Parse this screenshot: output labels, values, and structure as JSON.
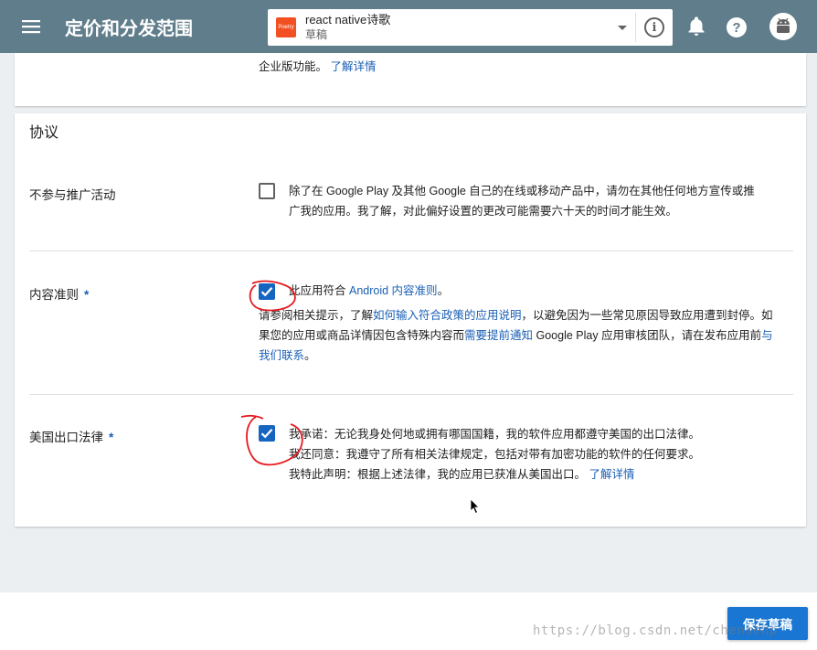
{
  "header": {
    "title": "定价和分发范围",
    "app_name": "react native诗歌",
    "app_status": "草稿",
    "app_icon_text": "Poetry",
    "icons": [
      "menu-icon",
      "info-icon",
      "bell-icon",
      "help-icon",
      "android-avatar-icon"
    ]
  },
  "top_card": {
    "text": "企业版功能。",
    "link": "了解详情"
  },
  "agreement": {
    "title": "协议",
    "promo": {
      "label": "不参与推广活动",
      "checked": false,
      "line1": "除了在 Google Play 及其他 Google 自己的在线或移动产品中，请勿在其他任何地方宣传或推",
      "line2": "广我的应用。我了解，对此偏好设置的更改可能需要六十天的时间才能生效。"
    },
    "content": {
      "label": "内容准则",
      "required": "*",
      "checked": true,
      "line1_pre": "此应用符合",
      "line1_link": "Android 内容准则",
      "line1_post": "。",
      "p_pre": "请参阅相关提示，了解",
      "p_link1": "如何输入符合政策的应用说明",
      "p_mid1": "，以避免因为一些常见原因导致应用遭到封停。如",
      "p_line2_pre": "果您的应用或商品详情因包含特殊内容而",
      "p_link2": "需要提前通知",
      "p_line2_post": " Google Play 应用审核团队，请在发布应用前",
      "p_link3a": "与",
      "p_link3b": "我们联系",
      "p_end": "。"
    },
    "export": {
      "label": "美国出口法律",
      "required": "*",
      "checked": true,
      "line1": "我承诺：无论我身处何地或拥有哪国国籍，我的软件应用都遵守美国的出口法律。",
      "line2": "我还同意：我遵守了所有相关法律规定，包括对带有加密功能的软件的任何要求。",
      "line3": "我特此声明：根据上述法律，我的应用已获准从美国出口。",
      "link": "了解详情"
    }
  },
  "footer": {
    "save_label": "保存草稿",
    "watermark": "https://blog.csdn.net/chensehp"
  },
  "colors": {
    "appbar": "#607d8b",
    "link": "#1a5fb4",
    "checkbox": "#1565c0",
    "save_button": "#1976d2",
    "annotation": "#e5191e"
  }
}
